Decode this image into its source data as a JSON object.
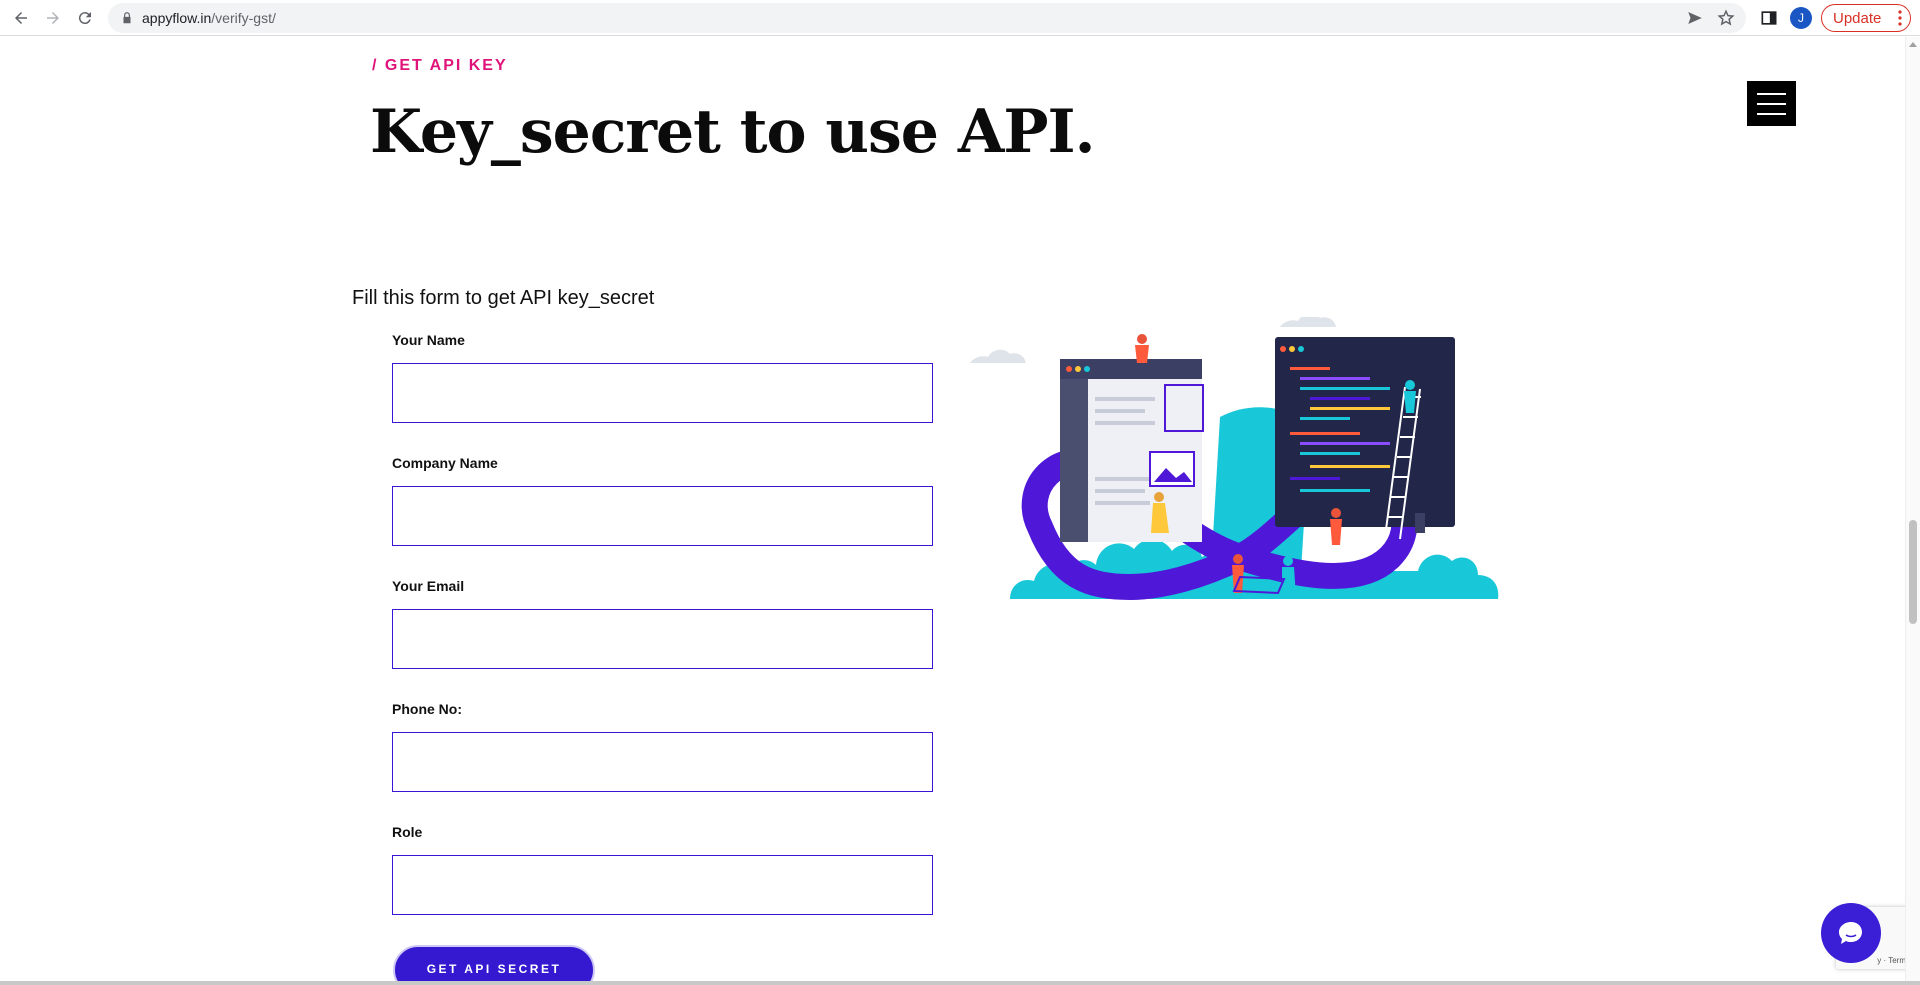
{
  "browser": {
    "url_domain": "appyflow.in",
    "url_path": "/verify-gst/",
    "update_label": "Update",
    "profile_initial": "J",
    "icons": [
      "back-icon",
      "forward-icon",
      "reload-icon",
      "lock-icon",
      "send-icon",
      "star-icon",
      "sidebar-icon",
      "more-icon"
    ]
  },
  "hero": {
    "eyebrow": "/ GET API KEY",
    "heading": "Key_secret to use API."
  },
  "form": {
    "title": "Fill this form to get API key_secret",
    "fields": [
      {
        "label": "Your Name",
        "value": ""
      },
      {
        "label": "Company Name",
        "value": ""
      },
      {
        "label": "Your Email",
        "value": ""
      },
      {
        "label": "Phone No:",
        "value": ""
      },
      {
        "label": "Role",
        "value": ""
      }
    ],
    "submit_label": "GET API SECRET"
  },
  "recaptcha": {
    "terms": "y · Terms"
  },
  "colors": {
    "accent_pink": "#e0137a",
    "accent_purple": "#3419d0",
    "input_border": "#3a14d8"
  }
}
